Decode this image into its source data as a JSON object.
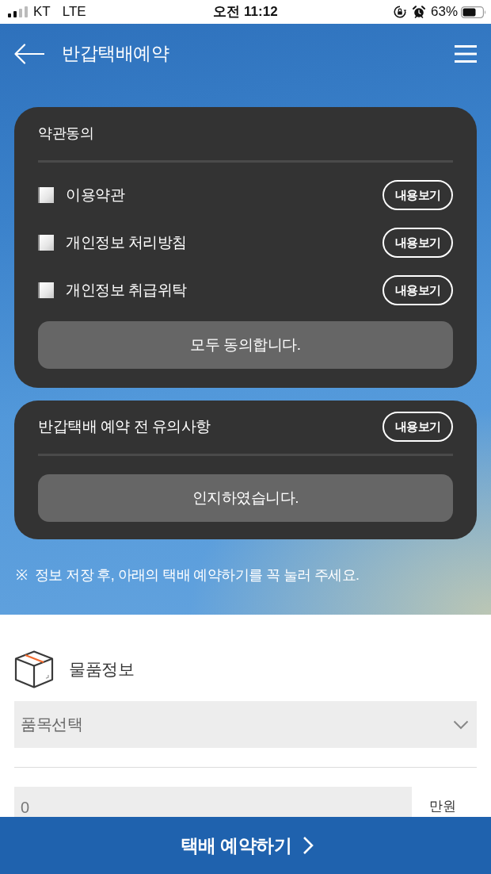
{
  "status_bar": {
    "carrier": "KT",
    "network": "LTE",
    "time": "오전 11:12",
    "battery_text": "63%"
  },
  "app_bar": {
    "title": "반갑택배예약"
  },
  "terms_card": {
    "title": "약관동의",
    "items": [
      {
        "label": "이용약관",
        "checked": false,
        "button": "내용보기"
      },
      {
        "label": "개인정보 처리방침",
        "checked": false,
        "button": "내용보기"
      },
      {
        "label": "개인정보 취급위탁",
        "checked": false,
        "button": "내용보기"
      }
    ],
    "agree_all_button": "모두 동의합니다."
  },
  "notice_card": {
    "title": "반갑택배 예약 전 유의사항",
    "button": "내용보기",
    "confirm_button": "인지하였습니다."
  },
  "note": {
    "mark": "※",
    "text": "정보 저장 후, 아래의 택배 예약하기를 꼭 눌러 주세요."
  },
  "item_info": {
    "title": "물품정보",
    "category_select": {
      "placeholder": "품목선택"
    },
    "amount_field": {
      "placeholder": "0"
    },
    "unit": "만원"
  },
  "bottom_button": {
    "label": "택배 예약하기"
  }
}
